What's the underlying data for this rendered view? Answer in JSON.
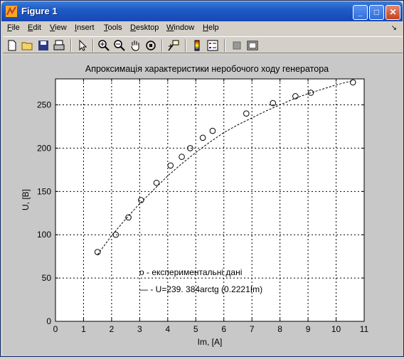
{
  "window": {
    "title": "Figure 1",
    "icon": "matlab-figure-icon",
    "controls": {
      "minimize": "_",
      "maximize": "□",
      "close": "✕"
    }
  },
  "menu": {
    "items": [
      {
        "label": "File",
        "key": "F"
      },
      {
        "label": "Edit",
        "key": "E"
      },
      {
        "label": "View",
        "key": "V"
      },
      {
        "label": "Insert",
        "key": "I"
      },
      {
        "label": "Tools",
        "key": "T"
      },
      {
        "label": "Desktop",
        "key": "D"
      },
      {
        "label": "Window",
        "key": "W"
      },
      {
        "label": "Help",
        "key": "H"
      }
    ],
    "dock_arrow": "↘"
  },
  "toolbar": {
    "icons": [
      "new-file-icon",
      "open-folder-icon",
      "save-icon",
      "print-icon",
      "select-arrow-icon",
      "zoom-in-icon",
      "zoom-out-icon",
      "pan-hand-icon",
      "rotate-3d-icon",
      "data-cursor-icon",
      "colorbar-icon",
      "legend-icon",
      "hide-tools-icon",
      "show-tools-icon"
    ]
  },
  "chart_data": {
    "type": "scatter",
    "title": "Апроксимація характеристики неробочого ходу генератора",
    "xlabel": "Im, [A]",
    "ylabel": "U, [B]",
    "xlim": [
      0,
      11
    ],
    "ylim": [
      0,
      280
    ],
    "xticks": [
      "0",
      "1",
      "2",
      "3",
      "4",
      "5",
      "6",
      "7",
      "8",
      "9",
      "10",
      "11"
    ],
    "yticks": [
      "0",
      "50",
      "100",
      "150",
      "200",
      "250"
    ],
    "grid": true,
    "series": [
      {
        "name": "o - експериментальні дані",
        "style": "markers",
        "x": [
          1.5,
          2.15,
          2.6,
          3.05,
          3.6,
          4.1,
          4.5,
          4.8,
          5.25,
          5.6,
          6.8,
          7.75,
          8.55,
          9.1,
          10.6
        ],
        "y": [
          80,
          100,
          120,
          140,
          160,
          180,
          190,
          200,
          212,
          220,
          240,
          252,
          260,
          264,
          276
        ]
      },
      {
        "name": "— - U=239. 384arctg (0.2221Im)",
        "style": "dashed-line",
        "x": [
          1.5,
          2.0,
          2.5,
          3.0,
          3.5,
          4.0,
          4.5,
          5.0,
          5.5,
          6.0,
          6.5,
          7.0,
          7.5,
          8.0,
          8.5,
          9.0,
          9.5,
          10.0,
          10.6
        ],
        "y": [
          77,
          99,
          118,
          136,
          152,
          168,
          182,
          195,
          207,
          218,
          227,
          235,
          243,
          250,
          257,
          263,
          268,
          273,
          278
        ]
      }
    ],
    "legend_location": "bottom-center"
  }
}
